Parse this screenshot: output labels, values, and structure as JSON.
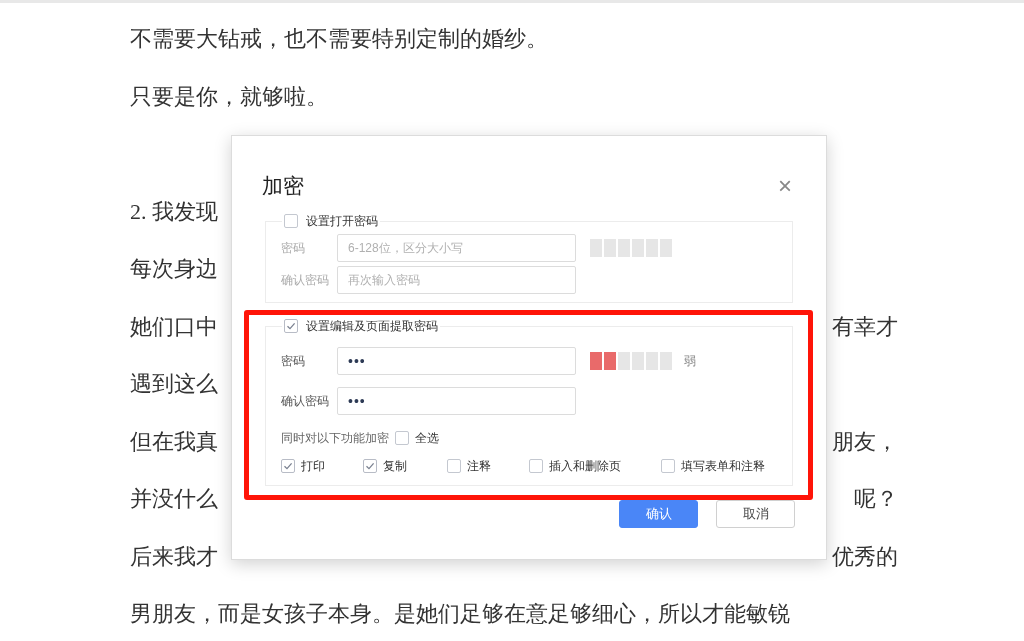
{
  "document": {
    "lines": [
      {
        "left": "不需要大钻戒，也不需要特别定制的婚纱。"
      },
      {
        "left": "只要是你，就够啦。"
      },
      {
        "left": "2. 我发现"
      },
      {
        "left": "每次身边"
      },
      {
        "left": "她们口中",
        "right": "有幸才"
      },
      {
        "left": "遇到这么"
      },
      {
        "left": "但在我真",
        "right": "朋友，"
      },
      {
        "left": "并没什么",
        "right": "呢？"
      },
      {
        "left": "后来我才",
        "right": "优秀的"
      },
      {
        "left": "男朋友，而是女孩子本身。是她们足够在意足够细心，所以才能敏锐"
      }
    ]
  },
  "dialog": {
    "title": "加密",
    "close": "×",
    "sections": [
      {
        "label": "设置打开密码",
        "checked": false,
        "highlighted": false,
        "fields": [
          {
            "kind": "with_meter",
            "label": "密码",
            "placeholder": "6-128位，区分大小写"
          },
          {
            "kind": "plain",
            "label": "确认密码",
            "placeholder": "再次输入密码"
          }
        ]
      },
      {
        "label": "设置编辑及页面提取密码",
        "checked": true,
        "highlighted": true,
        "fields": [
          {
            "kind": "with_meter",
            "label": "密码",
            "value": "•••",
            "meter": {
              "level": 0.33,
              "reading": "弱"
            }
          },
          {
            "kind": "plain",
            "label": "确认密码",
            "value": "•••"
          }
        ],
        "options_label": "同时对以下功能加密",
        "select_all": {
          "label": "全选",
          "checked": false
        },
        "options": [
          {
            "label": "打印",
            "checked": true
          },
          {
            "label": "复制",
            "checked": true
          },
          {
            "label": "注释",
            "checked": false
          },
          {
            "label": "插入和删除页",
            "checked": false
          },
          {
            "label": "填写表单和注释",
            "checked": false
          }
        ]
      }
    ],
    "buttons": [
      {
        "label": "确认",
        "kind": "primary"
      },
      {
        "label": "取消",
        "kind": "secondary"
      }
    ]
  }
}
